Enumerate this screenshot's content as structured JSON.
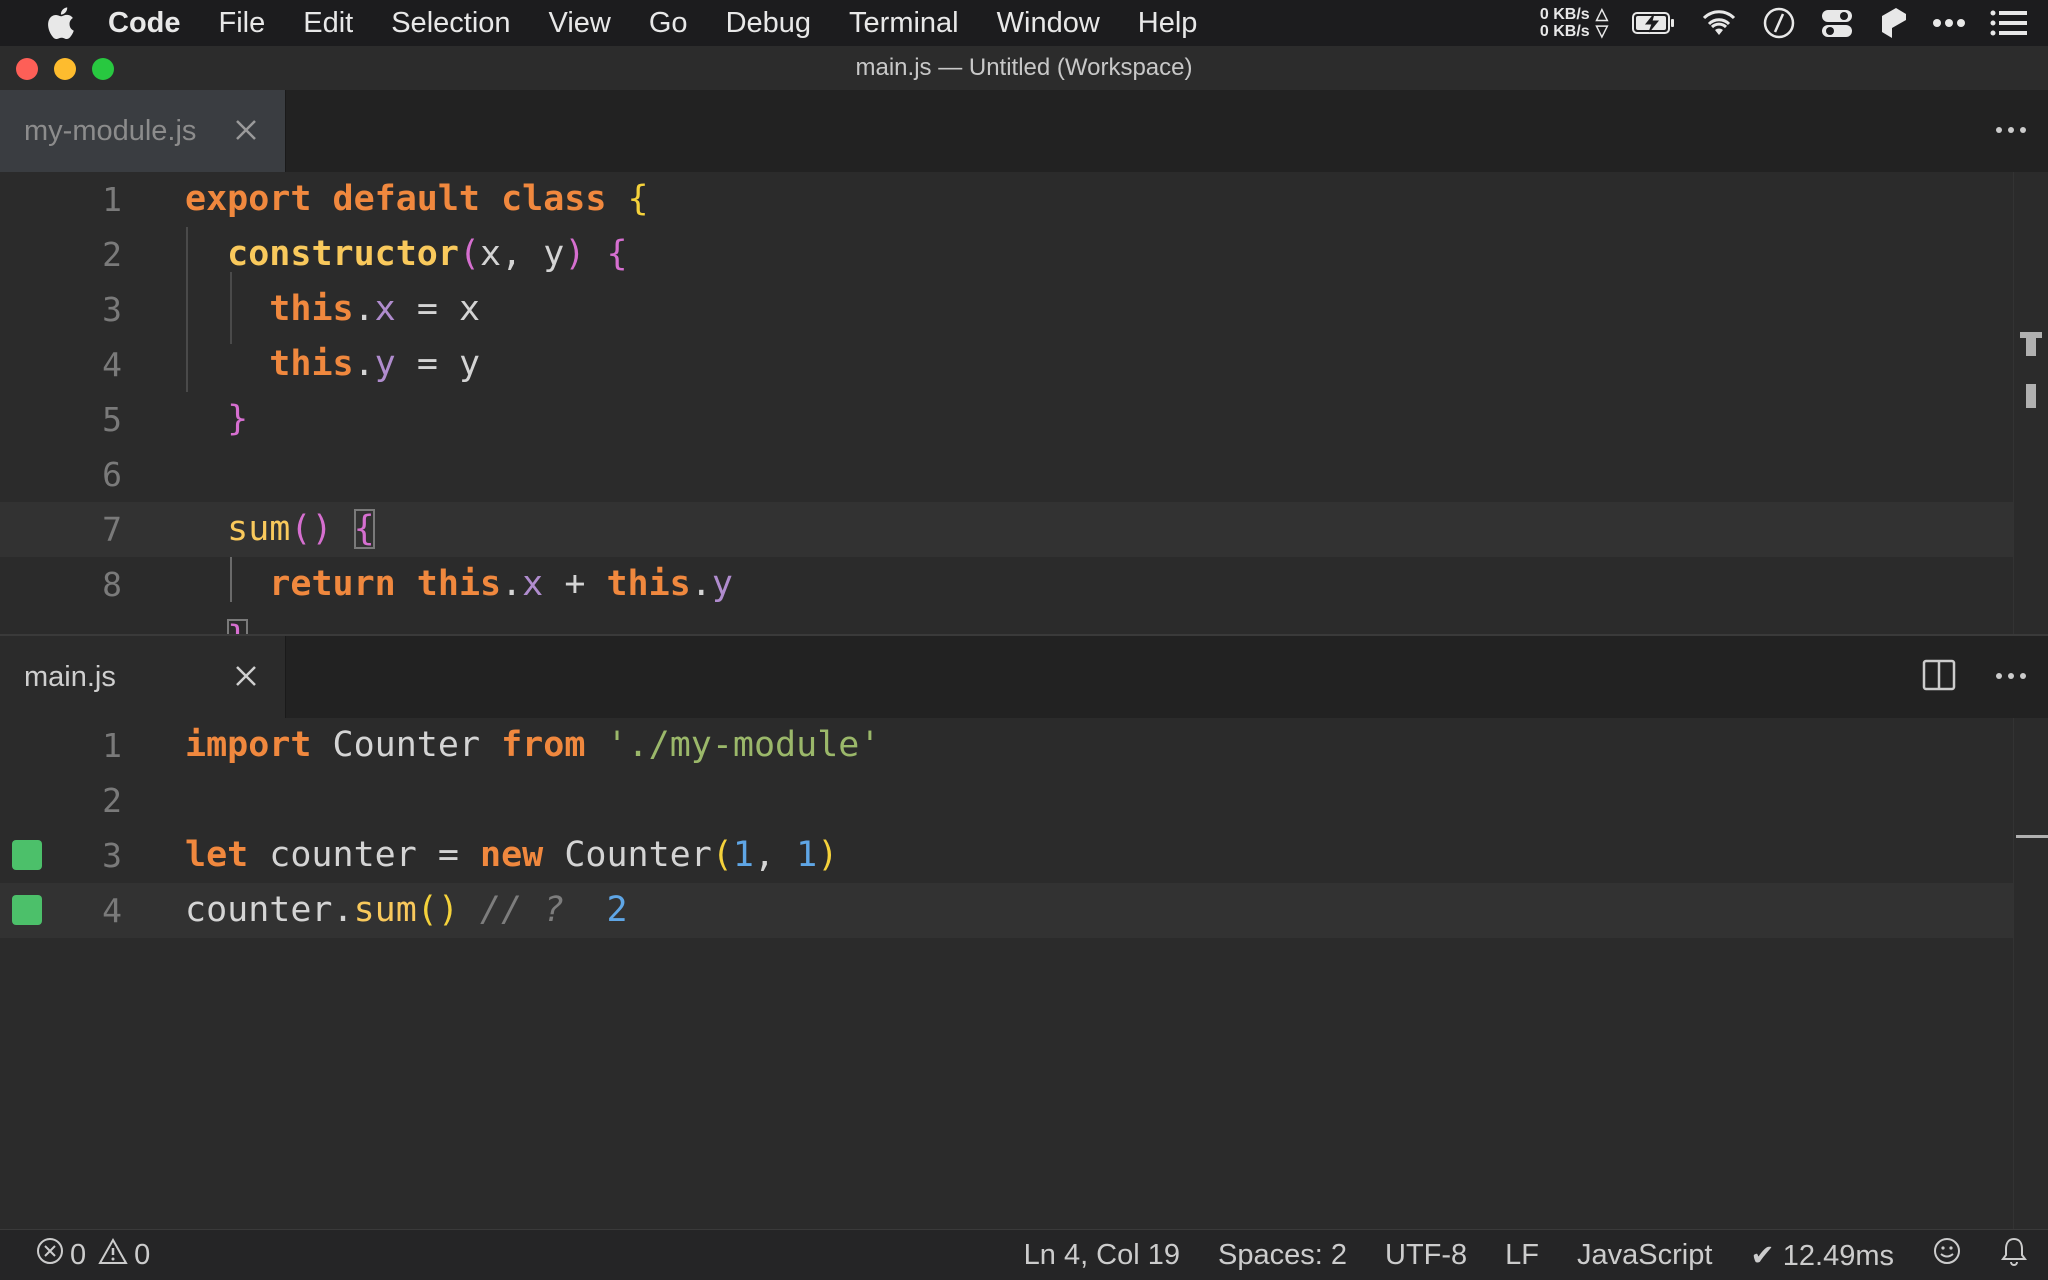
{
  "menubar": {
    "app_name": "Code",
    "items": [
      "File",
      "Edit",
      "Selection",
      "View",
      "Go",
      "Debug",
      "Terminal",
      "Window",
      "Help"
    ],
    "net_up": "0 KB/s",
    "net_down": "0 KB/s",
    "icons": [
      "apple-icon",
      "battery-charging-icon",
      "wifi-icon",
      "time-machine-icon",
      "control-center-icon",
      "app-icon",
      "more-icon",
      "list-icon"
    ]
  },
  "window": {
    "title": "main.js — Untitled (Workspace)"
  },
  "top_editor": {
    "tab_label": "my-module.js",
    "line_numbers": [
      "1",
      "2",
      "3",
      "4",
      "5",
      "6",
      "7",
      "8"
    ]
  },
  "bottom_editor": {
    "tab_label": "main.js",
    "line_numbers": [
      "1",
      "2",
      "3",
      "4"
    ],
    "inline_result": "2"
  },
  "status": {
    "errors": "0",
    "warnings": "0",
    "position": "Ln 4, Col 19",
    "spaces": "Spaces: 2",
    "encoding": "UTF-8",
    "eol": "LF",
    "language": "JavaScript",
    "timing": "✔ 12.49ms"
  },
  "colors": {
    "keyword": "#f0883e",
    "function": "#f9c95c",
    "property": "#b08cce",
    "string": "#9bb86a",
    "number": "#5fa6e6",
    "coverage": "#4cc06a"
  }
}
